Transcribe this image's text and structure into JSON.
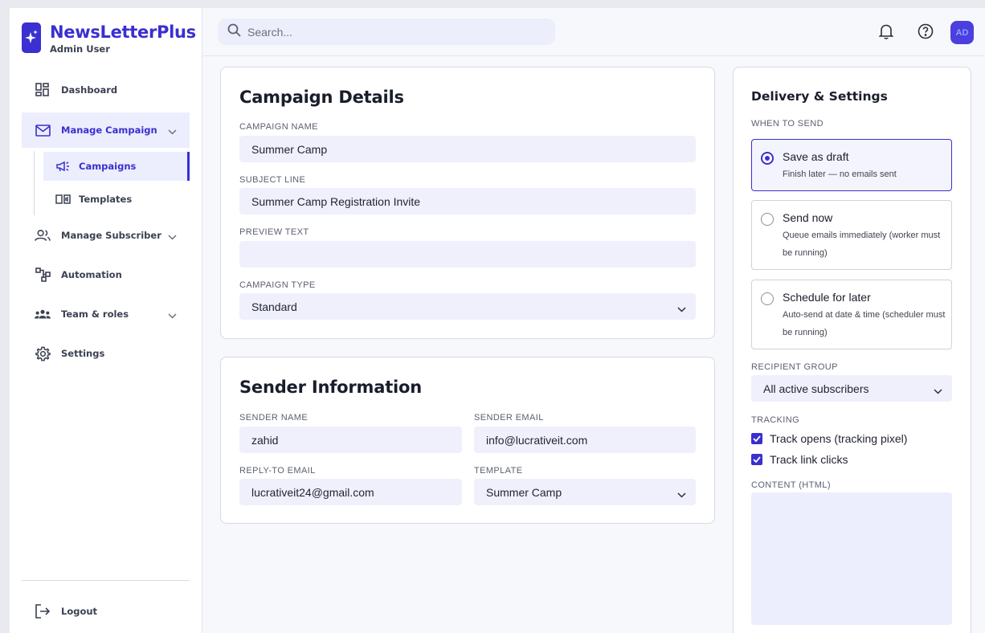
{
  "brand": {
    "title": "NewsLetterPlus",
    "subtitle": "Admin User"
  },
  "sidebar": {
    "items": [
      {
        "label": "Dashboard"
      },
      {
        "label": "Manage Campaign"
      },
      {
        "label": "Manage Subscriber"
      },
      {
        "label": "Automation"
      },
      {
        "label": "Team & roles"
      },
      {
        "label": "Settings"
      }
    ],
    "sub_items": [
      {
        "label": "Campaigns"
      },
      {
        "label": "Templates"
      }
    ],
    "logout": "Logout"
  },
  "topbar": {
    "search_placeholder": "Search...",
    "avatar_initials": "AD"
  },
  "campaign_details": {
    "title": "Campaign Details",
    "name_label": "CAMPAIGN NAME",
    "name_value": "Summer Camp",
    "subject_label": "SUBJECT LINE",
    "subject_value": "Summer Camp Registration Invite",
    "preview_label": "PREVIEW TEXT",
    "preview_value": "",
    "type_label": "CAMPAIGN TYPE",
    "type_value": "Standard"
  },
  "sender_info": {
    "title": "Sender Information",
    "sender_name_label": "SENDER NAME",
    "sender_name_value": "zahid",
    "sender_email_label": "SENDER EMAIL",
    "sender_email_value": "info@lucrativeit.com",
    "reply_to_label": "REPLY-TO EMAIL",
    "reply_to_value": "lucrativeit24@gmail.com",
    "template_label": "TEMPLATE",
    "template_value": "Summer Camp"
  },
  "delivery": {
    "title": "Delivery & Settings",
    "when_label": "WHEN TO SEND",
    "options": [
      {
        "title": "Save as draft",
        "desc": "Finish later — no emails sent",
        "selected": true
      },
      {
        "title": "Send now",
        "desc": "Queue emails immediately (worker must be running)",
        "selected": false
      },
      {
        "title": "Schedule for later",
        "desc": "Auto-send at date & time (scheduler must be running)",
        "selected": false
      }
    ],
    "recipient_label": "RECIPIENT GROUP",
    "recipient_value": "All active subscribers",
    "tracking_label": "TRACKING",
    "tracking_opens": "Track opens (tracking pixel)",
    "tracking_clicks": "Track link clicks",
    "content_label": "CONTENT (HTML)"
  },
  "colors": {
    "accent": "#3a2fd0",
    "field_bg": "#eff0fc",
    "active_bg": "#eceefd"
  }
}
